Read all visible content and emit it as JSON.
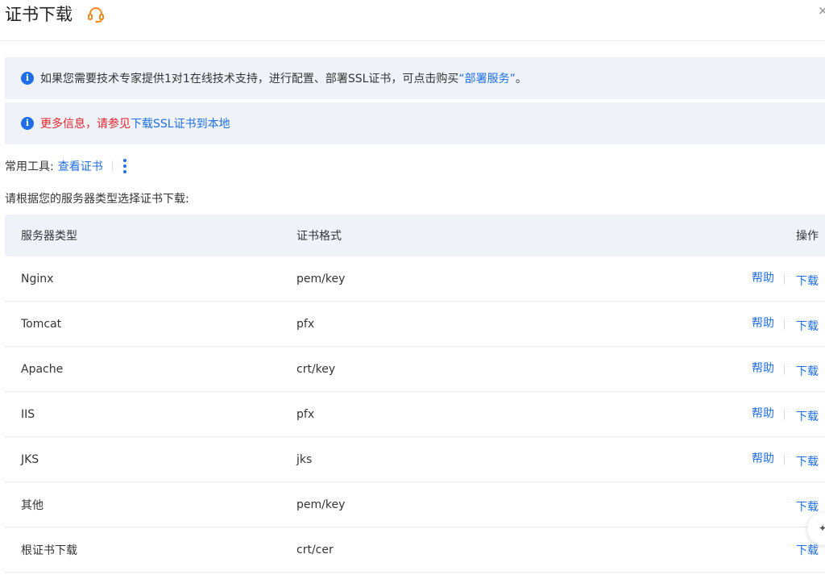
{
  "header": {
    "title": "证书下载",
    "close_label": "×"
  },
  "alerts": {
    "first": {
      "text": "如果您需要技术专家提供1对1在线技术支持，进行配置、部署SSL证书，可点击购买",
      "link": "“部署服务”",
      "suffix": "。"
    },
    "second": {
      "red_text": "更多信息，请参见",
      "link": "下载SSL证书到本地"
    }
  },
  "tools": {
    "label": "常用工具:",
    "view_cert": "查看证书"
  },
  "instruction": "请根据您的服务器类型选择证书下载:",
  "table": {
    "headers": {
      "type": "服务器类型",
      "format": "证书格式",
      "action": "操作"
    },
    "rows": [
      {
        "type": "Nginx",
        "format": "pem/key",
        "help": "帮助",
        "download": "下载"
      },
      {
        "type": "Tomcat",
        "format": "pfx",
        "help": "帮助",
        "download": "下载"
      },
      {
        "type": "Apache",
        "format": "crt/key",
        "help": "帮助",
        "download": "下载"
      },
      {
        "type": "IIS",
        "format": "pfx",
        "help": "帮助",
        "download": "下载"
      },
      {
        "type": "JKS",
        "format": "jks",
        "help": "帮助",
        "download": "下载"
      },
      {
        "type": "其他",
        "format": "pem/key",
        "download": "下载"
      },
      {
        "type": "根证书下载",
        "format": "crt/cer",
        "download": "下载"
      }
    ]
  },
  "colors": {
    "link": "#1e6ee8",
    "accent_orange": "#f58b1f",
    "alert_bg": "#eff3f9",
    "error_red": "#e0262c"
  },
  "icons": {
    "support": "headset-icon",
    "info": "info-circle-icon",
    "more": "vertical-dots-icon",
    "close": "close-icon"
  }
}
